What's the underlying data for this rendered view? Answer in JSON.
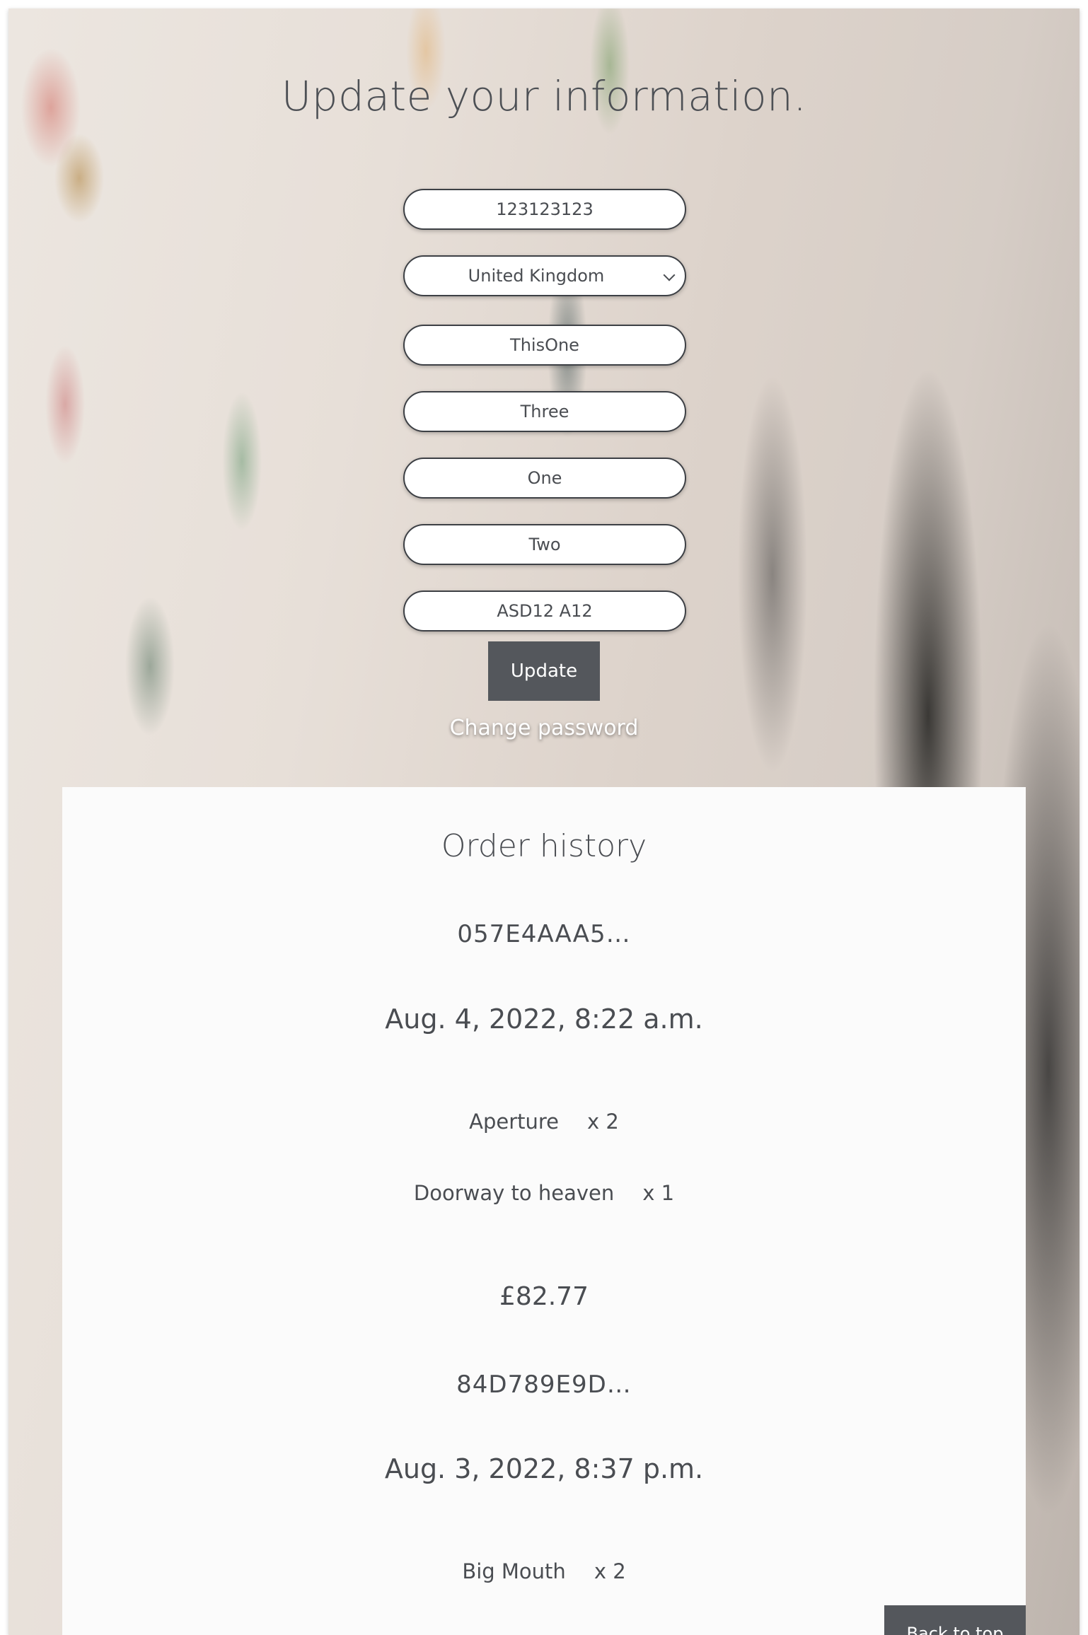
{
  "form": {
    "title": "Update your information.",
    "phone": "123123123",
    "country": "United Kingdom",
    "town": "ThisOne",
    "county": "Three",
    "address_line1": "One",
    "address_line2": "Two",
    "postcode": "ASD12 A12",
    "update_label": "Update",
    "change_password_label": "Change password"
  },
  "orders": {
    "title": "Order history",
    "list": [
      {
        "id": "057E4AAA5…",
        "date": "Aug. 4, 2022, 8:22 a.m.",
        "items": [
          {
            "name": "Aperture",
            "qty": "x 2"
          },
          {
            "name": "Doorway to heaven",
            "qty": "x 1"
          }
        ],
        "total": "£82.77"
      },
      {
        "id": "84D789E9D…",
        "date": "Aug. 3, 2022, 8:37 p.m.",
        "items": [
          {
            "name": "Big Mouth",
            "qty": "x 2"
          }
        ]
      }
    ]
  },
  "back_to_top_label": "Back to top"
}
